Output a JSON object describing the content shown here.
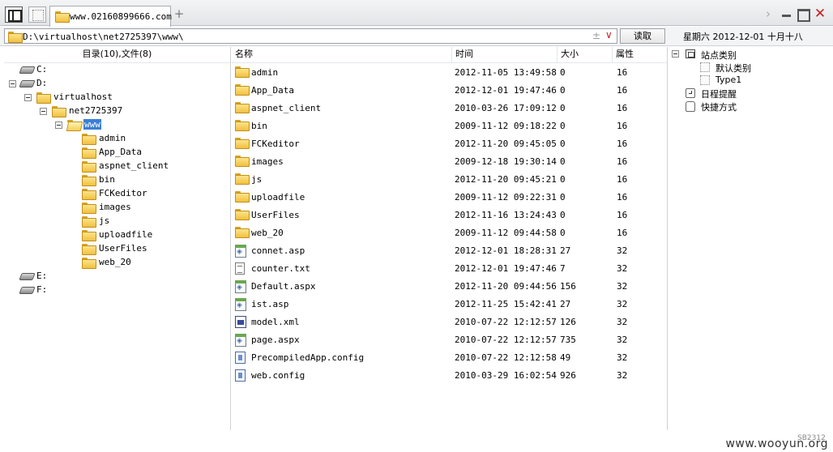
{
  "tabs": {
    "active_title": "www.02160899666.com",
    "new_tab_label": "+"
  },
  "window": {
    "forward_glyph": "›",
    "close_glyph": "✕"
  },
  "address": {
    "path": "D:\\virtualhost\\net2725397\\www\\",
    "plus_glyph": "±",
    "dropdown_glyph": "∨",
    "read_label": "读取"
  },
  "date_display": "星期六 2012-12-01 十月十八",
  "left": {
    "header": "目录(10),文件(8)",
    "tree": [
      {
        "label": "C:",
        "type": "drive",
        "level": 0,
        "expander": false
      },
      {
        "label": "D:",
        "type": "drive",
        "level": 0,
        "expander": true
      },
      {
        "label": "virtualhost",
        "type": "folder",
        "level": 1,
        "expander": true
      },
      {
        "label": "net2725397",
        "type": "folder",
        "level": 2,
        "expander": true
      },
      {
        "label": "www",
        "type": "folder-open",
        "level": 3,
        "expander": true,
        "selected": true
      },
      {
        "label": "admin",
        "type": "folder",
        "level": 4,
        "expander": false
      },
      {
        "label": "App_Data",
        "type": "folder",
        "level": 4,
        "expander": false
      },
      {
        "label": "aspnet_client",
        "type": "folder",
        "level": 4,
        "expander": false
      },
      {
        "label": "bin",
        "type": "folder",
        "level": 4,
        "expander": false
      },
      {
        "label": "FCKeditor",
        "type": "folder",
        "level": 4,
        "expander": false
      },
      {
        "label": "images",
        "type": "folder",
        "level": 4,
        "expander": false
      },
      {
        "label": "js",
        "type": "folder",
        "level": 4,
        "expander": false
      },
      {
        "label": "uploadfile",
        "type": "folder",
        "level": 4,
        "expander": false
      },
      {
        "label": "UserFiles",
        "type": "folder",
        "level": 4,
        "expander": false
      },
      {
        "label": "web_20",
        "type": "folder",
        "level": 4,
        "expander": false
      },
      {
        "label": "E:",
        "type": "drive",
        "level": 0,
        "expander": false
      },
      {
        "label": "F:",
        "type": "drive",
        "level": 0,
        "expander": false
      }
    ]
  },
  "files": {
    "columns": [
      "名称",
      "时间",
      "大小",
      "属性"
    ],
    "rows": [
      {
        "name": "admin",
        "time": "2012-11-05 13:49:58",
        "size": "0",
        "attr": "16",
        "type": "folder"
      },
      {
        "name": "App_Data",
        "time": "2012-12-01 19:47:46",
        "size": "0",
        "attr": "16",
        "type": "folder"
      },
      {
        "name": "aspnet_client",
        "time": "2010-03-26 17:09:12",
        "size": "0",
        "attr": "16",
        "type": "folder"
      },
      {
        "name": "bin",
        "time": "2009-11-12 09:18:22",
        "size": "0",
        "attr": "16",
        "type": "folder"
      },
      {
        "name": "FCKeditor",
        "time": "2012-11-20 09:45:05",
        "size": "0",
        "attr": "16",
        "type": "folder"
      },
      {
        "name": "images",
        "time": "2009-12-18 19:30:14",
        "size": "0",
        "attr": "16",
        "type": "folder"
      },
      {
        "name": "js",
        "time": "2012-11-20 09:45:21",
        "size": "0",
        "attr": "16",
        "type": "folder"
      },
      {
        "name": "uploadfile",
        "time": "2009-11-12 09:22:31",
        "size": "0",
        "attr": "16",
        "type": "folder"
      },
      {
        "name": "UserFiles",
        "time": "2012-11-16 13:24:43",
        "size": "0",
        "attr": "16",
        "type": "folder"
      },
      {
        "name": "web_20",
        "time": "2009-11-12 09:44:58",
        "size": "0",
        "attr": "16",
        "type": "folder"
      },
      {
        "name": "connet.asp",
        "time": "2012-12-01 18:28:31",
        "size": "27",
        "attr": "32",
        "type": "asp"
      },
      {
        "name": "counter.txt",
        "time": "2012-12-01 19:47:46",
        "size": "7",
        "attr": "32",
        "type": "txt"
      },
      {
        "name": "Default.aspx",
        "time": "2012-11-20 09:44:56",
        "size": "156",
        "attr": "32",
        "type": "asp"
      },
      {
        "name": "ist.asp",
        "time": "2012-11-25 15:42:41",
        "size": "27",
        "attr": "32",
        "type": "asp"
      },
      {
        "name": "model.xml",
        "time": "2010-07-22 12:12:57",
        "size": "126",
        "attr": "32",
        "type": "xml"
      },
      {
        "name": "page.aspx",
        "time": "2010-07-22 12:12:57",
        "size": "735",
        "attr": "32",
        "type": "asp"
      },
      {
        "name": "PrecompiledApp.config",
        "time": "2010-07-22 12:12:58",
        "size": "49",
        "attr": "32",
        "type": "cfg"
      },
      {
        "name": "web.config",
        "time": "2010-03-29 16:02:54",
        "size": "926",
        "attr": "32",
        "type": "cfg"
      }
    ]
  },
  "right": {
    "items": [
      {
        "label": "站点类别",
        "icon": "site-icon",
        "level": 0,
        "expander": true
      },
      {
        "label": "默认类别",
        "icon": "tag-icon",
        "level": 1,
        "expander": false
      },
      {
        "label": "Type1",
        "icon": "tag-icon",
        "level": 1,
        "expander": false
      },
      {
        "label": "日程提醒",
        "icon": "calendar-icon",
        "level": 0,
        "expander": false
      },
      {
        "label": "快捷方式",
        "icon": "shortcut-icon",
        "level": 0,
        "expander": false
      }
    ]
  },
  "watermark": "www.wooyun.org",
  "watermark_small": "SB2312",
  "colors": {
    "selection": "#3a7fd6",
    "close": "#c62020",
    "folder": "#f0c040"
  }
}
